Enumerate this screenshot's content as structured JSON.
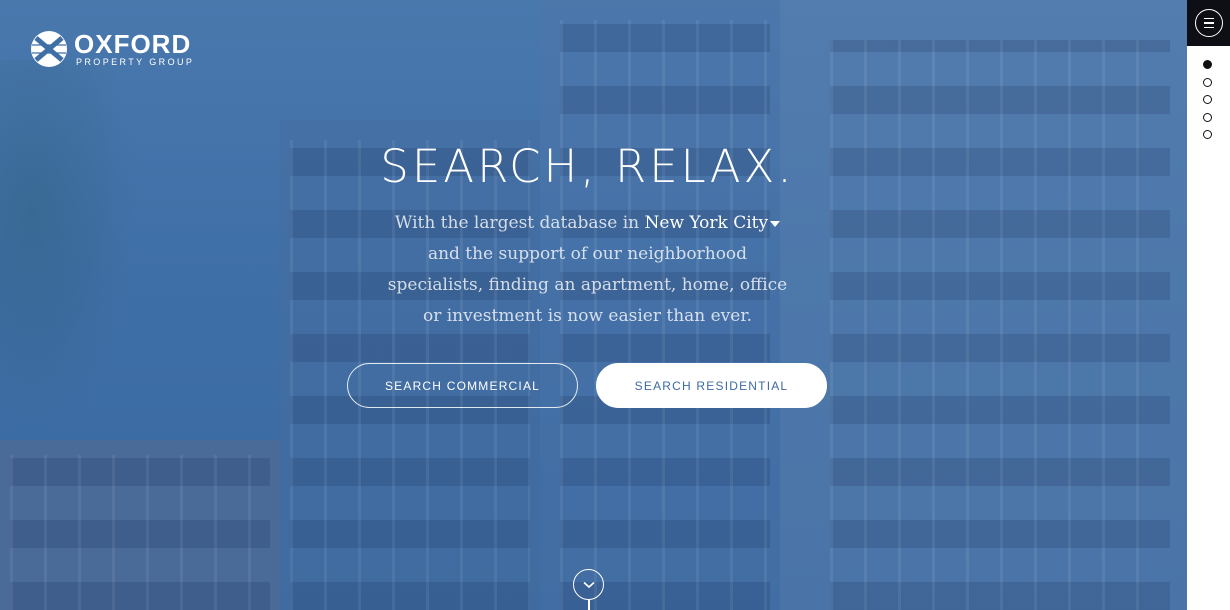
{
  "brand": {
    "name": "OXFORD",
    "subtitle": "PROPERTY GROUP",
    "icon": "oxford-x-logo"
  },
  "hero": {
    "headline": "SEARCH, RELAX.",
    "tagline_before": "With the largest database in ",
    "city": "New York City",
    "city_icon": "caret-down-icon",
    "tagline_after": " and the support of our neighborhood specialists, finding an apartment, home, office or investment is now easier than ever.",
    "buttons": {
      "commercial": "SEARCH COMMERCIAL",
      "residential": "SEARCH RESIDENTIAL"
    },
    "scroll_icon": "chevron-down-icon"
  },
  "nav": {
    "menu_icon": "hamburger-menu-icon",
    "section_dots": [
      {
        "active": true
      },
      {
        "active": false
      },
      {
        "active": false
      },
      {
        "active": false
      },
      {
        "active": false
      }
    ]
  },
  "colors": {
    "hero_overlay": "#3f6fa7",
    "button_text_residential": "#3e6aa3",
    "menu_background": "#0d0f14",
    "rail_background": "#ffffff"
  }
}
